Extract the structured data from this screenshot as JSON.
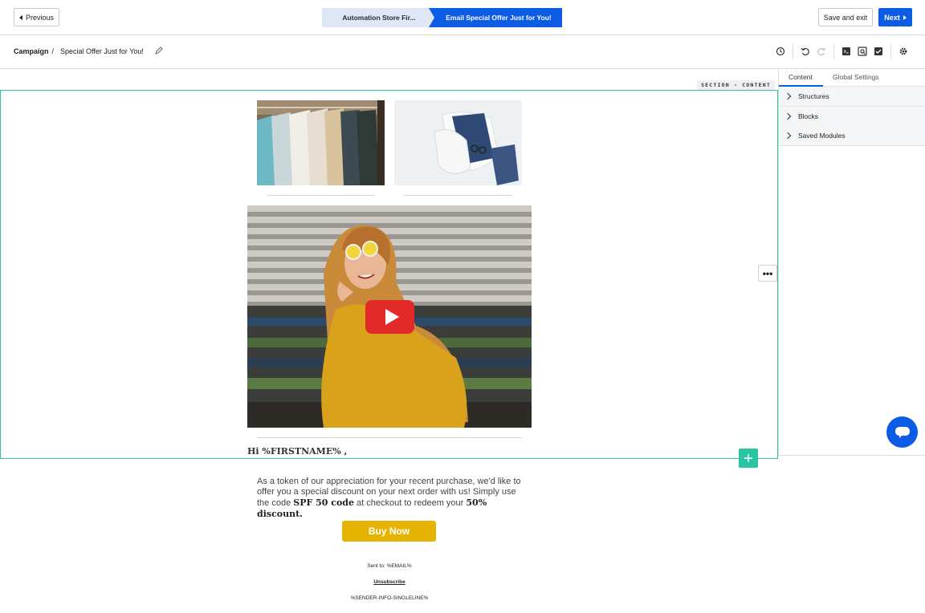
{
  "topbar": {
    "previous_label": "Previous",
    "steps": [
      "Automation Store Fir...",
      "Email Special Offer Just for You!"
    ],
    "save_exit_label": "Save and exit",
    "next_label": "Next"
  },
  "subbar": {
    "breadcrumb_root": "Campaign",
    "breadcrumb_sep": "/",
    "breadcrumb_current": "Special Offer Just for You!",
    "tools": [
      "history-icon",
      "undo-icon",
      "redo-icon",
      "code-icon",
      "preview-icon",
      "image-check-icon",
      "settings-icon"
    ]
  },
  "canvas": {
    "section_tag": "SECTION - CONTENT",
    "greeting": "Hi %FIRSTNAME% ,",
    "body_part1": "As a token of our appreciation for your recent purchase, we'd like to offer you a special discount on your next order with us! Simply use the code ",
    "code": "SPF 50 code",
    "body_part2": " at checkout to redeem your ",
    "discount": "50% discount.",
    "buy_label": "Buy Now",
    "sent_to": "Sent to: %EMAIL%",
    "unsubscribe": "Unsubscribe",
    "sender_info": "%SENDER-INFO-SINGLELINE%",
    "more_label": "•••"
  },
  "panel": {
    "tabs": [
      "Content",
      "Global Settings"
    ],
    "sections": [
      "Structures",
      "Blocks",
      "Saved Modules"
    ]
  },
  "colors": {
    "accent_blue": "#0d5ce6",
    "selection_green": "#2bc4a2",
    "buy_button": "#e6b400",
    "video_play": "#d42a2a"
  }
}
